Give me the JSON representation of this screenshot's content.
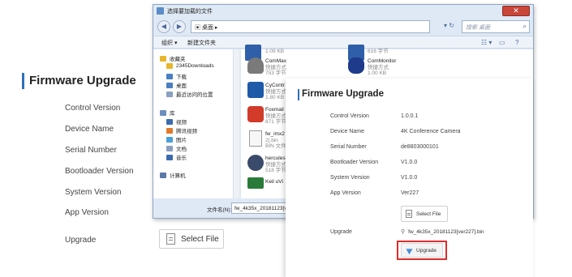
{
  "back_panel": {
    "title": "Firmware Upgrade",
    "rows": [
      "Control Version",
      "Device Name",
      "Serial Number",
      "Bootloader Version",
      "System Version",
      "App Version"
    ],
    "upgrade_label": "Upgrade",
    "select_file": "Select File"
  },
  "dialog": {
    "title": "选择要加载的文件",
    "path": "桌面",
    "search_placeholder": "搜索 桌面",
    "toolbar": {
      "organize": "组织 ▾",
      "new_folder": "新建文件夹"
    },
    "nav": [
      {
        "label": "收藏夹",
        "color": "#e8b62c"
      },
      {
        "label": "2345Downloads",
        "color": "#e8b62c",
        "sub": true
      },
      {
        "label": "下载",
        "color": "#4a7fc4",
        "sub": true
      },
      {
        "label": "桌面",
        "color": "#4a7fc4",
        "sub": true
      },
      {
        "label": "最近访问的位置",
        "color": "#8aa0bf",
        "sub": true
      },
      {
        "label": "库",
        "color": "#6a8fbd"
      },
      {
        "label": "视频",
        "color": "#3a6ab0",
        "sub": true
      },
      {
        "label": "腾讯视频",
        "color": "#e07b2a",
        "sub": true
      },
      {
        "label": "图片",
        "color": "#4aa0d8",
        "sub": true
      },
      {
        "label": "文档",
        "color": "#8aa0bf",
        "sub": true
      },
      {
        "label": "音乐",
        "color": "#3a6ab0",
        "sub": true
      },
      {
        "label": "计算机",
        "color": "#5a7aa8"
      }
    ],
    "files_left": [
      {
        "name": "",
        "sub": "1.09 KB"
      },
      {
        "name": "ComMax",
        "sub": "快捷方式\n753 字节"
      },
      {
        "name": "CyContr",
        "sub": "快捷方式\n1.80 KB"
      },
      {
        "name": "Foxmail",
        "sub": "快捷方式\n871 字节"
      },
      {
        "name": "fw_imx2",
        "sub": "2].bin\nBIN 文件"
      },
      {
        "name": "hercules",
        "sub": "快捷方式\n518 字节"
      },
      {
        "name": "Keil uVi",
        "sub": ""
      }
    ],
    "files_right": [
      {
        "name": "",
        "sub": "616 字节"
      },
      {
        "name": "ComMonitor",
        "sub": "快捷方式\n1.00 KB"
      }
    ],
    "filename_label": "文件名(N):",
    "filename_value": "fw_4k35x_20181123[ve"
  },
  "front_panel": {
    "title": "Firmware Upgrade",
    "rows": [
      {
        "label": "Control Version",
        "value": "1.0.0.1"
      },
      {
        "label": "Device Name",
        "value": "4K Conference Camera"
      },
      {
        "label": "Serial Number",
        "value": "de8803000101"
      },
      {
        "label": "Bootloader Version",
        "value": "V1.0.0"
      },
      {
        "label": "System Version",
        "value": "V1.0.0"
      },
      {
        "label": "App Version",
        "value": "Ver227"
      }
    ],
    "select_file": "Select File",
    "upgrade_label": "Upgrade",
    "file_name": "fw_4k35x_20181123[ver227].bin",
    "upgrade_button": "Upgrade",
    "highlight_color": "#e02b2b"
  }
}
